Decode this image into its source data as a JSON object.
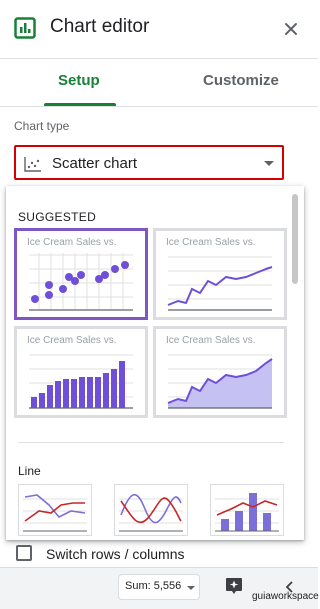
{
  "header": {
    "title": "Chart editor",
    "icon": "chart-icon",
    "close_icon": "close-icon"
  },
  "tabs": [
    {
      "label": "Setup",
      "active": true
    },
    {
      "label": "Customize",
      "active": false
    }
  ],
  "chart_type": {
    "label": "Chart type",
    "selected": "Scatter chart",
    "icon": "scatter-chart-icon"
  },
  "dropdown": {
    "section_suggested": "SUGGESTED",
    "suggestions": [
      {
        "title": "Ice Cream Sales vs.",
        "kind": "scatter",
        "selected": true
      },
      {
        "title": "Ice Cream Sales vs.",
        "kind": "line",
        "selected": false
      },
      {
        "title": "Ice Cream Sales vs.",
        "kind": "column",
        "selected": false
      },
      {
        "title": "Ice Cream Sales vs.",
        "kind": "area",
        "selected": false
      }
    ],
    "section_line": "Line",
    "line_options": [
      "line-chart",
      "smooth-line-chart",
      "combo-chart"
    ]
  },
  "switch_rows": {
    "label": "Switch rows / columns",
    "checked": false
  },
  "footer": {
    "sum_label": "Sum: 5,556",
    "watermark": "guiaworkspace"
  },
  "colors": {
    "accent": "#188038",
    "selection": "#7e57c2",
    "highlight": "#d50000",
    "series": "#6f4fd8"
  }
}
